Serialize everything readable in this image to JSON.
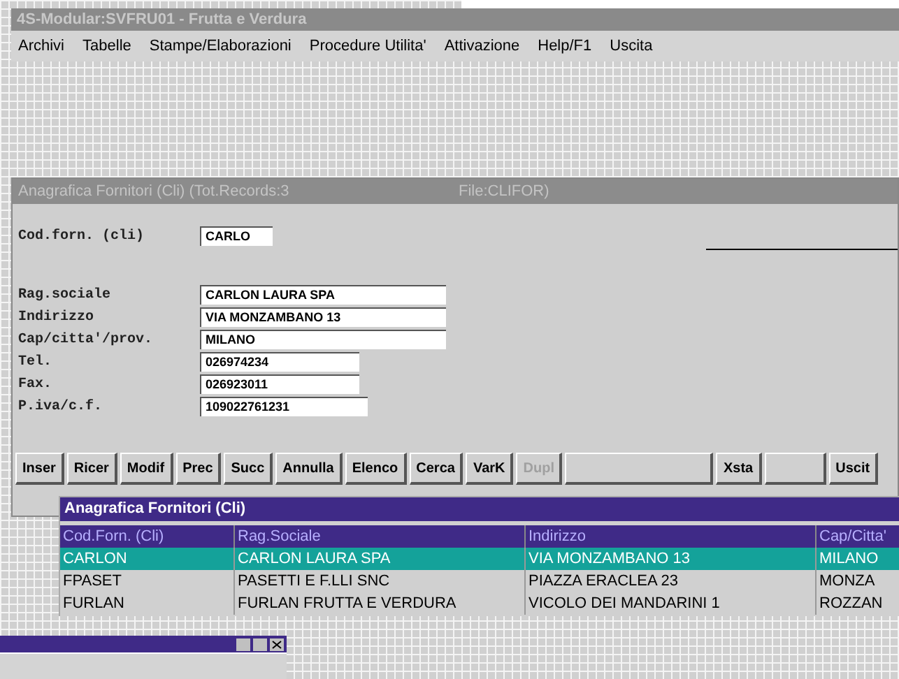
{
  "main_window": {
    "title": "4S-Modular:SVFRU01 - Frutta e Verdura"
  },
  "menu": [
    "Archivi",
    "Tabelle",
    "Stampe/Elaborazioni",
    "Procedure Utilita'",
    "Attivazione",
    "Help/F1",
    "Uscita"
  ],
  "form_window": {
    "title": "Anagrafica Fornitori  (Cli) (Tot.Records:3",
    "file": "File:CLIFOR)",
    "fields": [
      {
        "label": "Cod.forn. (cli)",
        "value": "CARLO"
      },
      {
        "label": "Rag.sociale",
        "value": "CARLON LAURA SPA"
      },
      {
        "label": "Indirizzo",
        "value": "VIA MONZAMBANO 13"
      },
      {
        "label": "Cap/citta'/prov.",
        "value": "MILANO"
      },
      {
        "label": "Tel.",
        "value": "026974234"
      },
      {
        "label": "Fax.",
        "value": "026923011"
      },
      {
        "label": "P.iva/c.f.",
        "value": "109022761231"
      }
    ],
    "buttons": [
      {
        "kind": "text",
        "label": "Inser",
        "disabled": false
      },
      {
        "kind": "text",
        "label": "Ricer",
        "disabled": false
      },
      {
        "kind": "text",
        "label": "Modif",
        "disabled": false
      },
      {
        "kind": "text",
        "label": "Prec",
        "disabled": false
      },
      {
        "kind": "text",
        "label": "Succ",
        "disabled": false
      },
      {
        "kind": "text",
        "label": "Annulla",
        "disabled": false
      },
      {
        "kind": "text",
        "label": "Elenco",
        "disabled": false
      },
      {
        "kind": "text",
        "label": "Cerca",
        "disabled": false
      },
      {
        "kind": "text",
        "label": "VarK",
        "disabled": false
      },
      {
        "kind": "text",
        "label": "Dupl",
        "disabled": true
      },
      {
        "kind": "blank"
      },
      {
        "kind": "text",
        "label": "Xsta",
        "disabled": false
      },
      {
        "kind": "blank"
      },
      {
        "kind": "text",
        "label": "Uscit",
        "disabled": false
      }
    ]
  },
  "grid_window": {
    "title": "Anagrafica Fornitori  (Cli)",
    "columns": [
      "Cod.Forn. (Cli)",
      "Rag.Sociale",
      "Indirizzo",
      "Cap/Citta'"
    ],
    "rows": [
      {
        "cells": [
          "CARLON",
          "CARLON LAURA SPA",
          "VIA MONZAMBANO 13",
          "MILANO"
        ],
        "selected": true
      },
      {
        "cells": [
          "FPASET",
          "PASETTI E F.LLI SNC",
          "PIAZZA ERACLEA 23",
          "MONZA"
        ],
        "selected": false
      },
      {
        "cells": [
          "FURLAN",
          "FURLAN FRUTTA E VERDURA",
          "VICOLO DEI MANDARINI 1",
          "ROZZAN"
        ],
        "selected": false
      }
    ]
  }
}
